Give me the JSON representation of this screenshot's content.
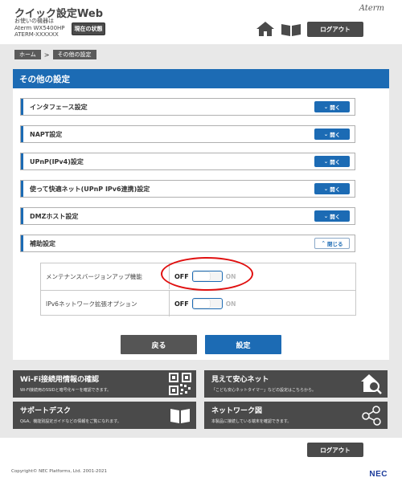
{
  "header": {
    "app_title": "クイック設定Web",
    "device_caption": "お使いの機器は",
    "device_model": "Aterm WX5400HP",
    "device_id": "ATERM-XXXXXX",
    "status_button": "現在の状態",
    "brand": "Aterm",
    "logout": "ログアウト"
  },
  "breadcrumb": {
    "home": "ホーム",
    "separator": ">",
    "current": "その他の設定"
  },
  "panel": {
    "title": "その他の設定",
    "open_label": "開く",
    "close_label": "閉じる",
    "sections": [
      {
        "label": "インタフェース設定"
      },
      {
        "label": "NAPT設定"
      },
      {
        "label": "UPnP(IPv4)設定"
      },
      {
        "label": "使って快適ネット(UPnP IPv6連携)設定"
      },
      {
        "label": "DMZホスト設定"
      },
      {
        "label": "補助設定"
      }
    ],
    "options": [
      {
        "label": "メンテナンスバージョンアップ機能",
        "off": "OFF",
        "on": "ON",
        "state": "OFF"
      },
      {
        "label": "IPv6ネットワーク拡張オプション",
        "off": "OFF",
        "on": "ON",
        "state": "OFF"
      }
    ]
  },
  "actions": {
    "back": "戻る",
    "submit": "設定"
  },
  "tiles": [
    {
      "title": "Wi-Fi接続用情報の確認",
      "desc": "Wi-Fi接続用のSSIDと暗号化キーを確認できます。",
      "icon": "qr-code-icon"
    },
    {
      "title": "見えて安心ネット",
      "desc": "「こども安心ネットタイマー」などの設定はこちらから。",
      "icon": "home-search-icon"
    },
    {
      "title": "サポートデスク",
      "desc": "Q&A、機能別設定ガイドなどの情報をご覧になれます。",
      "icon": "open-book-icon"
    },
    {
      "title": "ネットワーク図",
      "desc": "本製品に接続している端末を確認できます。",
      "icon": "network-share-icon"
    }
  ],
  "footer": {
    "logout": "ログアウト",
    "copyright": "Copyright© NEC Platforms, Ltd. 2001-2021",
    "logo": "NEC"
  },
  "colors": {
    "accent": "#1c6bb4",
    "dark_button": "#4a4a4a",
    "highlight": "#e01010",
    "band": "#e8e8e8"
  }
}
